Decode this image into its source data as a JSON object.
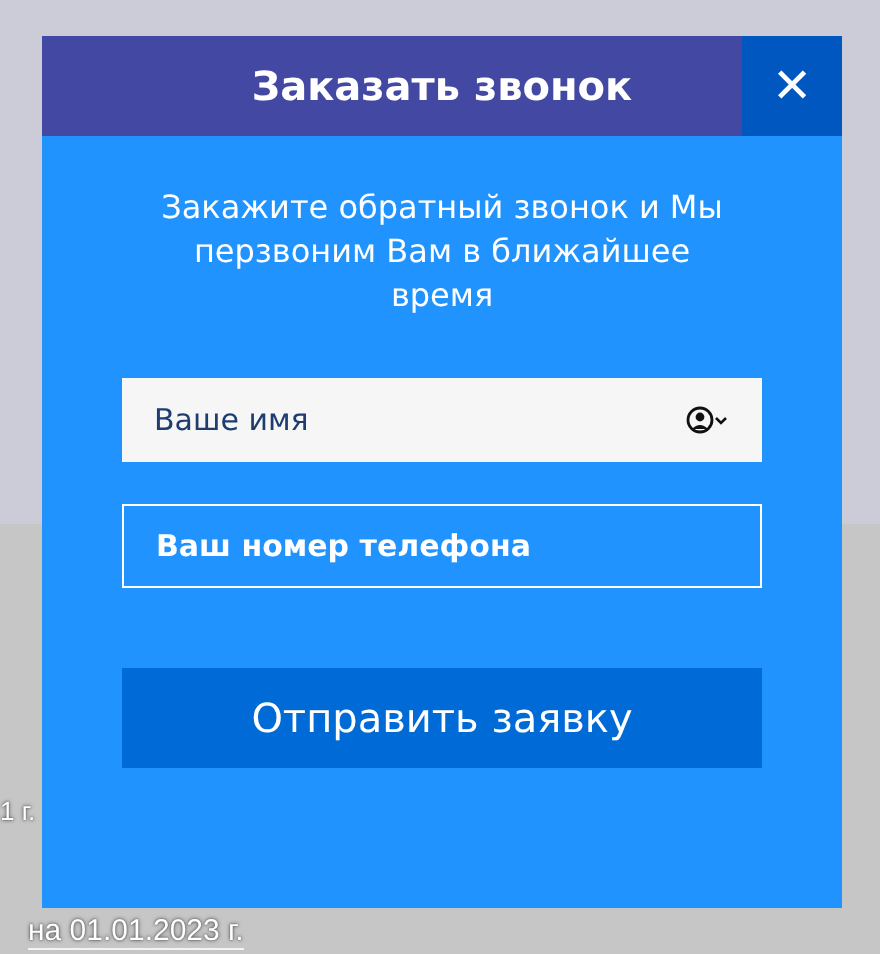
{
  "background": {
    "lines": [
      "1 г.",
      "на 01.01.2023 г."
    ]
  },
  "modal": {
    "title": "Заказать звонок",
    "close": "✕",
    "message": "Закажите обратный звонок и Мы перзвоним Вам в ближайшее время",
    "fields": [
      {
        "kind": "light",
        "placeholder": "Ваше имя",
        "autofill": true
      },
      {
        "kind": "outline",
        "placeholder": "Ваш номер телефона",
        "autofill": false
      }
    ],
    "submit": "Отправить заявку"
  }
}
